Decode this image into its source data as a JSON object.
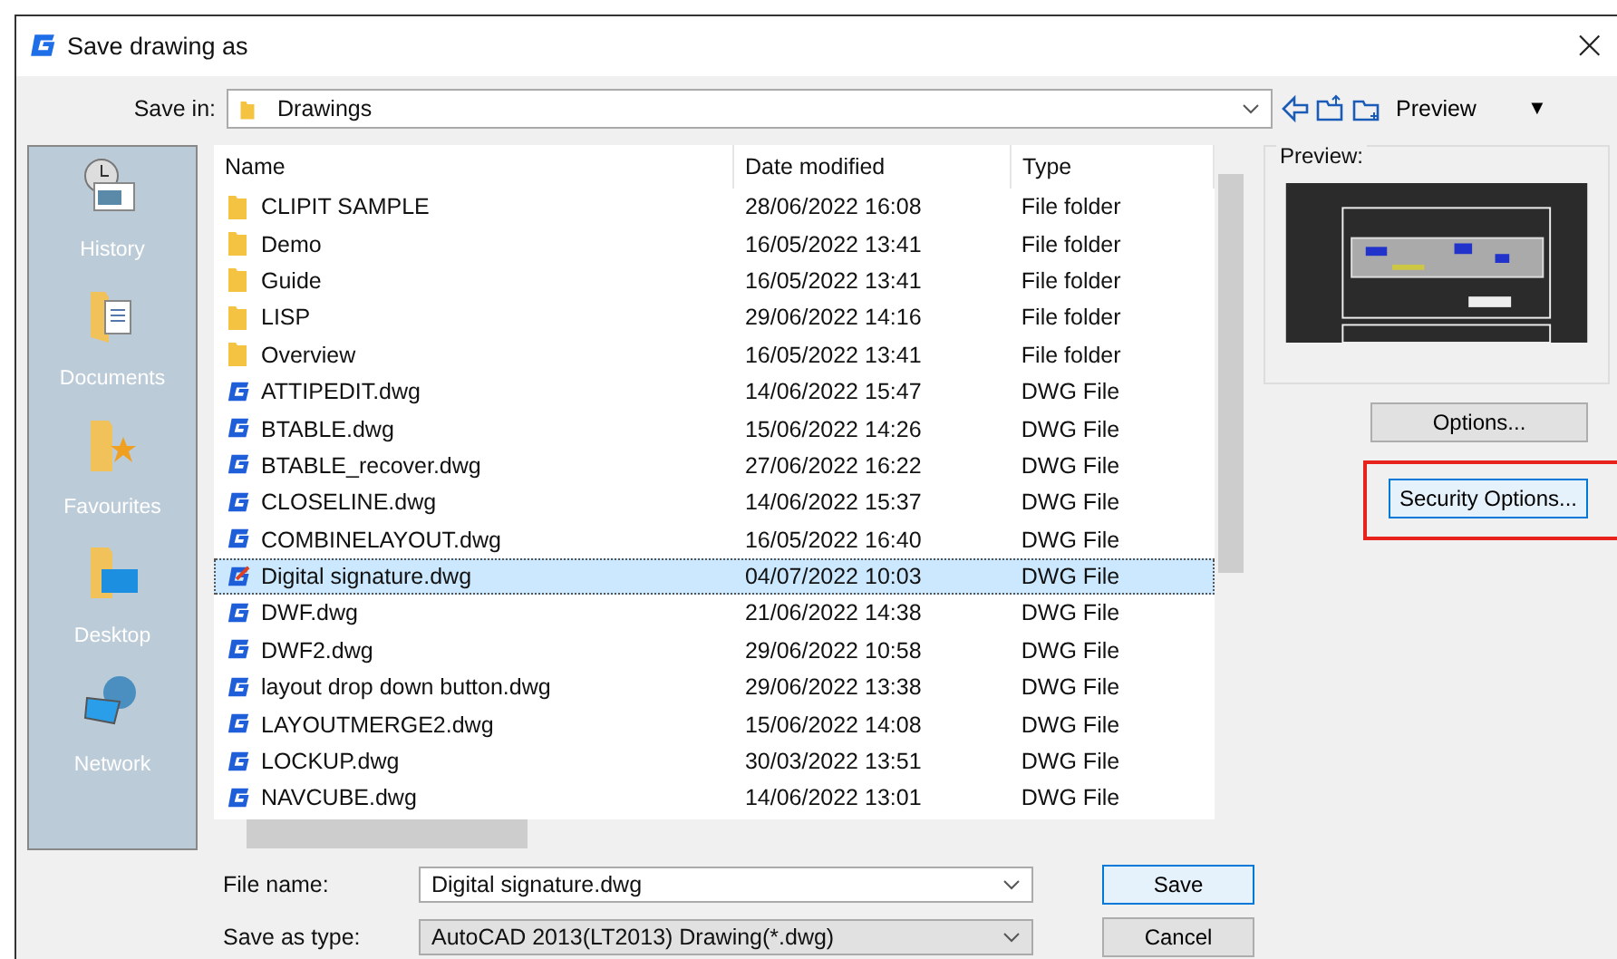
{
  "window": {
    "title": "Save drawing as",
    "close": "×"
  },
  "save_in": {
    "label": "Save in:",
    "value": "Drawings",
    "preview_menu": "Preview",
    "menu_arrow": "▼"
  },
  "sidebar": {
    "items": [
      {
        "label": "History",
        "kind": "history"
      },
      {
        "label": "Documents",
        "kind": "documents"
      },
      {
        "label": "Favourites",
        "kind": "favourites"
      },
      {
        "label": "Desktop",
        "kind": "desktop"
      },
      {
        "label": "Network",
        "kind": "network"
      }
    ]
  },
  "table": {
    "columns": [
      "Name",
      "Date modified",
      "Type"
    ],
    "rows": [
      {
        "name": "CLIPIT SAMPLE",
        "date": "28/06/2022 16:08",
        "type": "File folder",
        "kind": "folder",
        "selected": false
      },
      {
        "name": "Demo",
        "date": "16/05/2022 13:41",
        "type": "File folder",
        "kind": "folder",
        "selected": false
      },
      {
        "name": "Guide",
        "date": "16/05/2022 13:41",
        "type": "File folder",
        "kind": "folder",
        "selected": false
      },
      {
        "name": "LISP",
        "date": "29/06/2022 14:16",
        "type": "File folder",
        "kind": "folder",
        "selected": false
      },
      {
        "name": "Overview",
        "date": "16/05/2022 13:41",
        "type": "File folder",
        "kind": "folder",
        "selected": false
      },
      {
        "name": "ATTIPEDIT.dwg",
        "date": "14/06/2022 15:47",
        "type": "DWG File",
        "kind": "dwg",
        "selected": false
      },
      {
        "name": "BTABLE.dwg",
        "date": "15/06/2022 14:26",
        "type": "DWG File",
        "kind": "dwg",
        "selected": false
      },
      {
        "name": "BTABLE_recover.dwg",
        "date": "27/06/2022 16:22",
        "type": "DWG File",
        "kind": "dwg",
        "selected": false
      },
      {
        "name": "CLOSELINE.dwg",
        "date": "14/06/2022 15:37",
        "type": "DWG File",
        "kind": "dwg",
        "selected": false
      },
      {
        "name": "COMBINELAYOUT.dwg",
        "date": "16/05/2022 16:40",
        "type": "DWG File",
        "kind": "dwg",
        "selected": false
      },
      {
        "name": "Digital signature.dwg",
        "date": "04/07/2022 10:03",
        "type": "DWG File",
        "kind": "signed",
        "selected": true
      },
      {
        "name": "DWF.dwg",
        "date": "21/06/2022 14:38",
        "type": "DWG File",
        "kind": "dwg",
        "selected": false
      },
      {
        "name": "DWF2.dwg",
        "date": "29/06/2022 10:58",
        "type": "DWG File",
        "kind": "dwg",
        "selected": false
      },
      {
        "name": "layout drop down button.dwg",
        "date": "29/06/2022 13:38",
        "type": "DWG File",
        "kind": "dwg",
        "selected": false
      },
      {
        "name": "LAYOUTMERGE2.dwg",
        "date": "15/06/2022 14:08",
        "type": "DWG File",
        "kind": "dwg",
        "selected": false
      },
      {
        "name": "LOCKUP.dwg",
        "date": "30/03/2022 13:51",
        "type": "DWG File",
        "kind": "dwg",
        "selected": false
      },
      {
        "name": "NAVCUBE.dwg",
        "date": "14/06/2022 13:01",
        "type": "DWG File",
        "kind": "dwg",
        "selected": false
      }
    ]
  },
  "preview": {
    "label": "Preview:"
  },
  "side_buttons": [
    {
      "label": "Options...",
      "highlighted": false
    },
    {
      "label": "Security Options...",
      "highlighted": true
    }
  ],
  "file_name": {
    "label": "File name:",
    "value": "Digital signature.dwg"
  },
  "save_as_type": {
    "label": "Save as type:",
    "value": "AutoCAD 2013(LT2013) Drawing(*.dwg)"
  },
  "buttons": [
    {
      "label": "Save",
      "default": true
    },
    {
      "label": "Cancel",
      "default": false
    }
  ]
}
